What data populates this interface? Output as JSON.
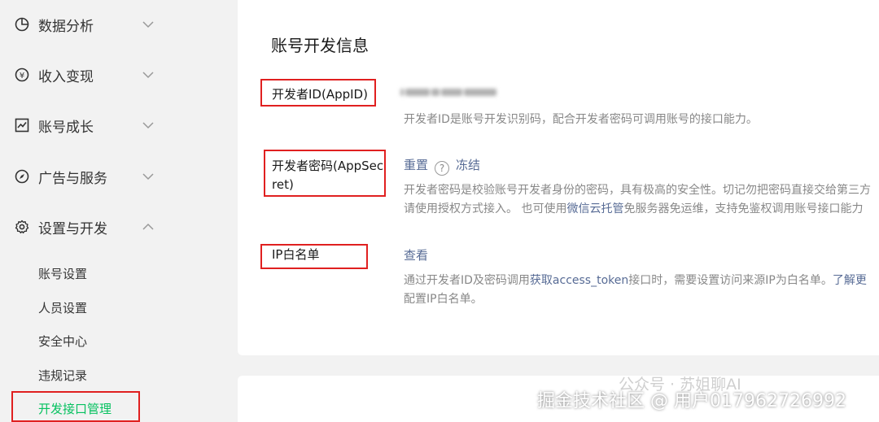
{
  "sidebar": {
    "groups": [
      {
        "label": "数据分析",
        "icon": "pie-chart-icon"
      },
      {
        "label": "收入变现",
        "icon": "yen-icon"
      },
      {
        "label": "账号成长",
        "icon": "trend-chart-icon"
      },
      {
        "label": "广告与服务",
        "icon": "compass-icon"
      },
      {
        "label": "设置与开发",
        "icon": "gear-icon"
      }
    ],
    "sub_items": [
      "账号设置",
      "人员设置",
      "安全中心",
      "违规记录",
      "开发接口管理"
    ],
    "active_sub": "开发接口管理"
  },
  "main": {
    "title": "账号开发信息",
    "appid": {
      "label": "开发者ID(AppID)",
      "desc": "开发者ID是账号开发识别码，配合开发者密码可调用账号的接口能力。"
    },
    "secret": {
      "label_line1": "开发者密码(AppSec",
      "label_line2": "ret)",
      "reset": "重置",
      "help": "?",
      "freeze": "冻结",
      "desc_line1": "开发者密码是校验账号开发者身份的密码，具有极高的安全性。切记勿把密码直接交给第三方",
      "desc_line2_a": "请使用授权方式接入。 也可使用",
      "desc_line2_link": "微信云托管",
      "desc_line2_b": "免服务器免运维，支持免鉴权调用账号接口能力"
    },
    "ip": {
      "label": "IP白名单",
      "view": "查看",
      "desc_line1_a": "通过开发者ID及密码调用",
      "desc_line1_link": "获取access_token",
      "desc_line1_b": "接口时，需要设置访问来源IP为白名单。",
      "desc_line1_link2": "了解更",
      "desc_line2": "配置IP白名单。"
    }
  },
  "watermark": {
    "line1": "公众号 · 苏姐聊AI",
    "line2": "掘金技术社区 @ 用户017962726992"
  },
  "colors": {
    "accent": "#07c160",
    "link": "#576b95",
    "highlight": "#e02020"
  }
}
